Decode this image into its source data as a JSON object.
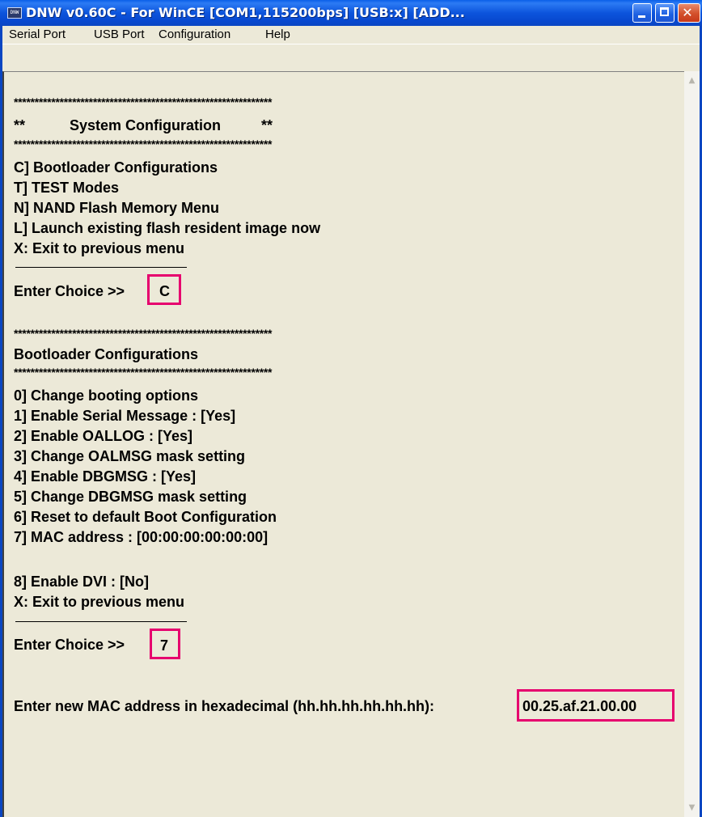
{
  "window": {
    "title": "DNW v0.60C - For WinCE   [COM1,115200bps] [USB:x] [ADD...",
    "icon_label": "DNW",
    "title_icon": "dnw-app-icon",
    "controls": [
      "minimize-icon",
      "maximize-icon",
      "close-icon"
    ]
  },
  "menu": {
    "items": [
      "Serial Port",
      "USB Port",
      "Configuration",
      "Help"
    ]
  },
  "console": {
    "stars": "**************************************************************",
    "sys_header": "**           System Configuration          **",
    "sys_items": [
      "C] Bootloader Configurations",
      "T] TEST Modes",
      "N] NAND Flash Memory Menu",
      "L] Launch existing flash resident image now",
      "X: Exit to previous menu"
    ],
    "prompt1": "Enter Choice >>",
    "choice1": "C",
    "boot_header": "Bootloader Configurations",
    "boot_items": [
      "0] Change booting options",
      "1] Enable Serial Message : [Yes]",
      "2] Enable OALLOG : [Yes]",
      "3] Change OALMSG mask setting",
      "4] Enable DBGMSG : [Yes]",
      "5] Change DBGMSG mask setting",
      "6] Reset to default Boot Configuration",
      "7] MAC address : [00:00:00:00:00:00]"
    ],
    "boot_items2": [
      "8] Enable DVI : [No]",
      "X: Exit to previous menu"
    ],
    "prompt2": "Enter Choice >>",
    "choice2": "7",
    "mac_prompt": "Enter new MAC address in hexadecimal (hh.hh.hh.hh.hh.hh):",
    "mac_value": "00.25.af.21.00.00"
  },
  "colors": {
    "highlight": "#e6006e",
    "titlebar": "#0a46c2"
  }
}
